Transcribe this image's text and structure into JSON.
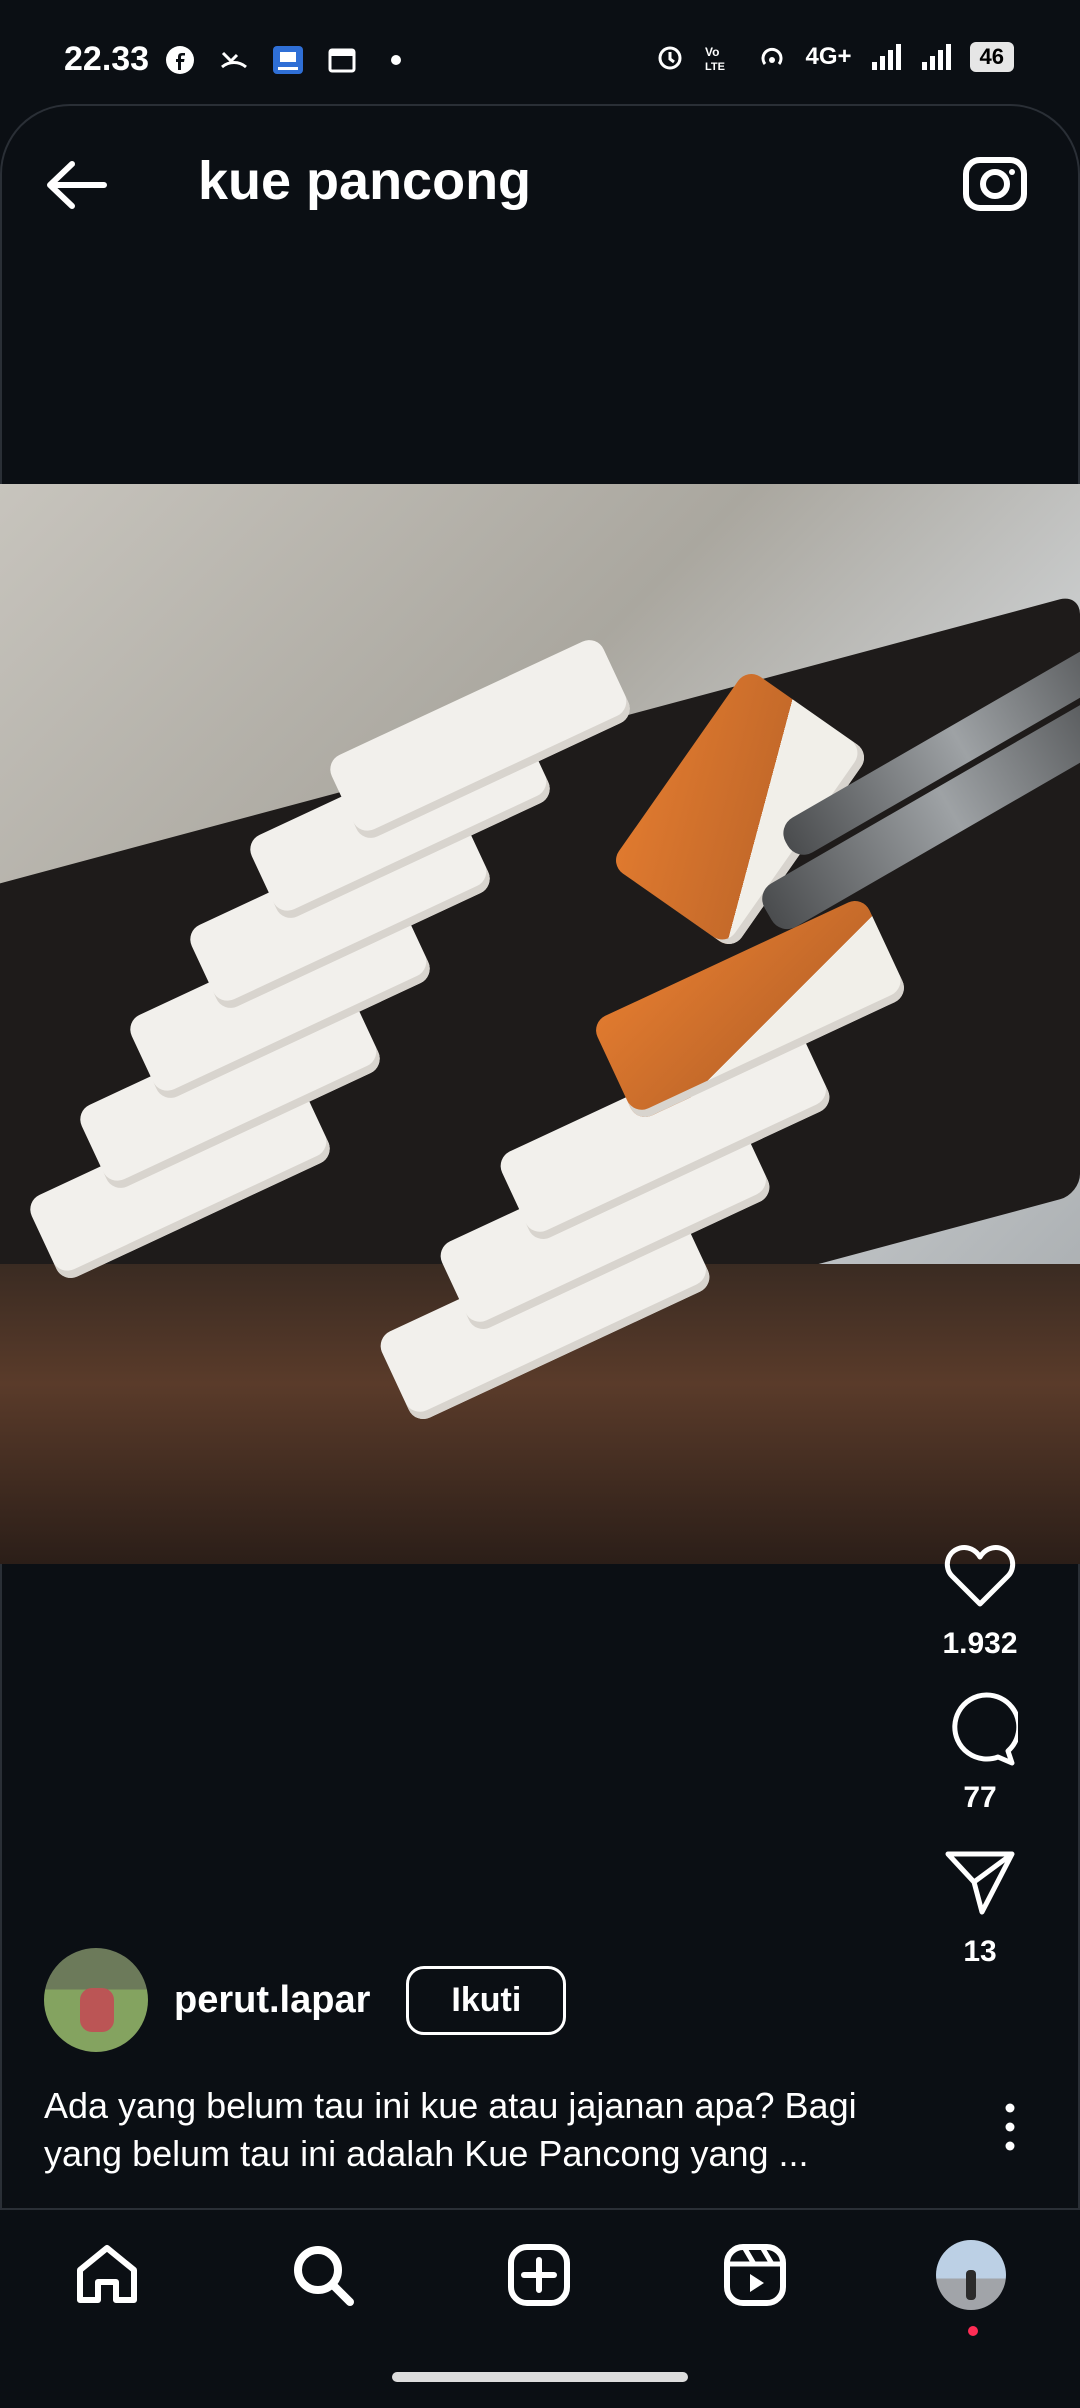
{
  "status": {
    "time": "22.33",
    "network": "4G+",
    "battery": "46"
  },
  "header": {
    "title": "kue pancong"
  },
  "post": {
    "likes": "1.932",
    "comments": "77",
    "shares": "13",
    "author": "perut.lapar",
    "follow_label": "Ikuti",
    "caption_line1": "Ada yang belum tau ini kue atau jajanan apa? Bagi",
    "caption_line2": "yang belum tau ini adalah Kue Pancong yang ..."
  },
  "icons": {
    "back": "arrow-left-icon",
    "camera": "camera-icon",
    "like": "heart-icon",
    "comment": "comment-icon",
    "share": "paper-plane-icon",
    "more": "more-vertical-icon",
    "home": "home-icon",
    "search": "search-icon",
    "create": "plus-square-icon",
    "reels": "reels-icon"
  }
}
